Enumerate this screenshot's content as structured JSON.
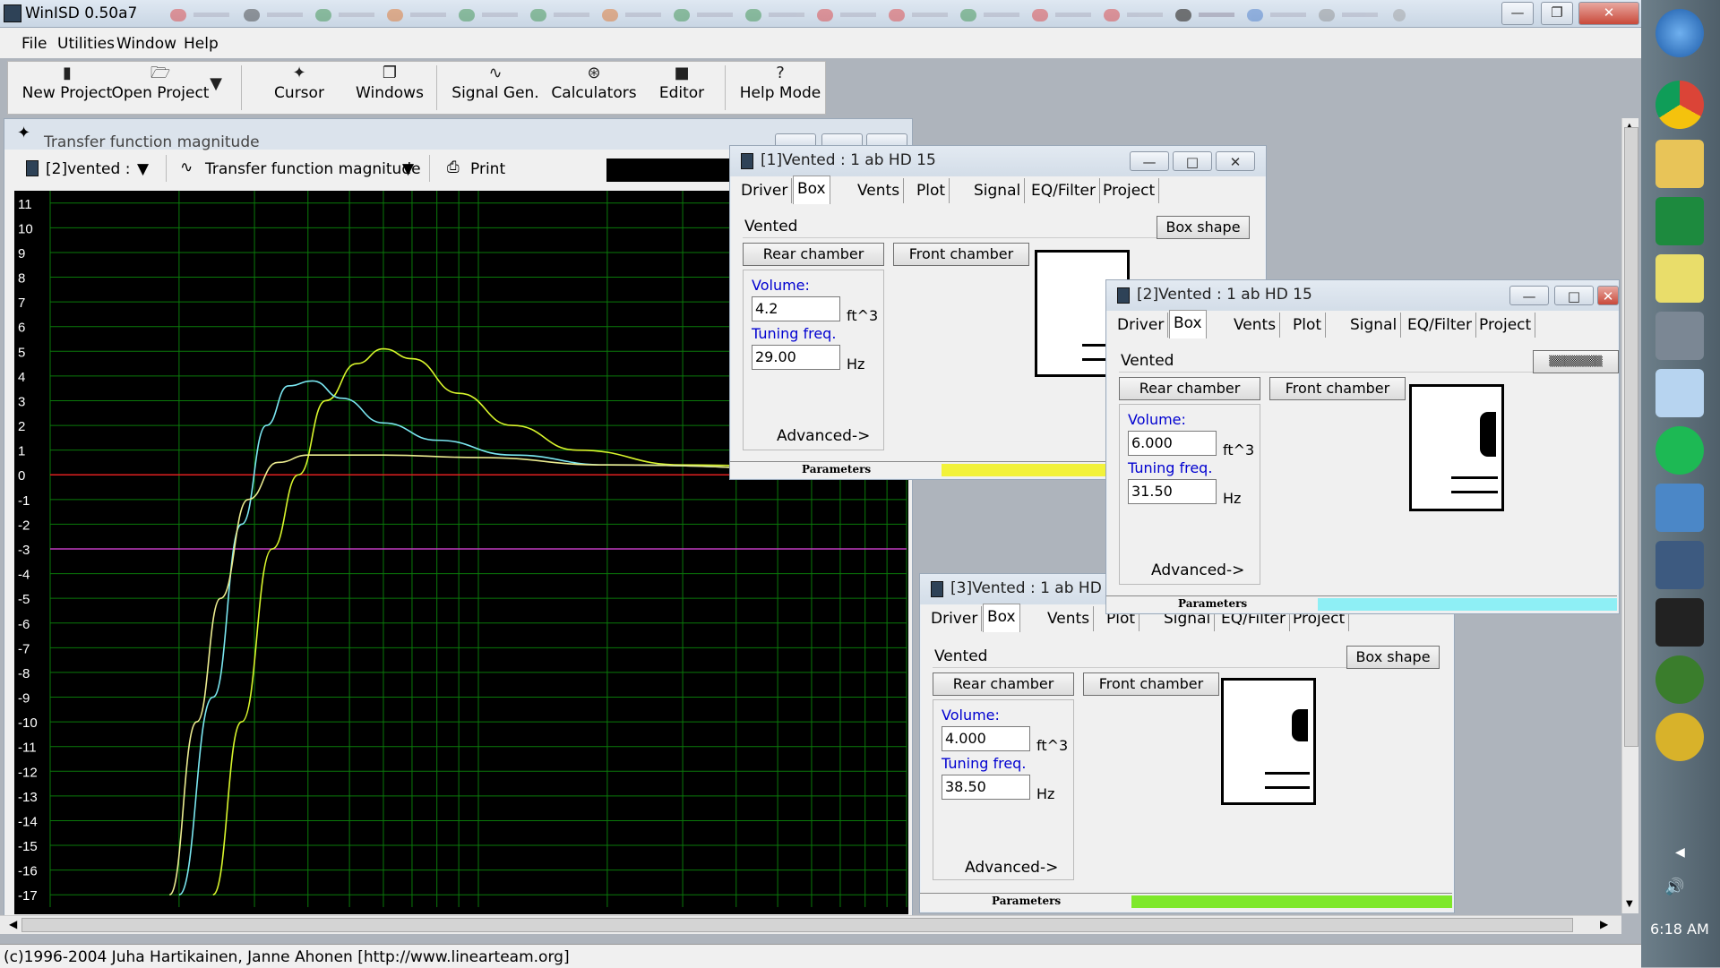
{
  "app": {
    "title": "WinISD 0.50a7"
  },
  "menu": [
    "File",
    "Utilities",
    "Window",
    "Help"
  ],
  "toolbar": {
    "new_project": "New Project",
    "open_project": "Open Project",
    "cursor": "Cursor",
    "windows": "Windows",
    "signal_gen": "Signal Gen.",
    "calculators": "Calculators",
    "editor": "Editor",
    "help_mode": "Help Mode"
  },
  "graph": {
    "title": "Transfer function magnitude",
    "project_select": "[2]vented :",
    "plot_select": "Transfer function magnitude",
    "print": "Print",
    "y_ticks": [
      "11",
      "10",
      "9",
      "8",
      "7",
      "6",
      "5",
      "4",
      "3",
      "2",
      "1",
      "0",
      "-1",
      "-2",
      "-3",
      "-4",
      "-5",
      "-6",
      "-7",
      "-8",
      "-9",
      "-10",
      "-11",
      "-12",
      "-13",
      "-14",
      "-15",
      "-16",
      "-17"
    ]
  },
  "chart_data": {
    "type": "line",
    "ylim": [
      -17.5,
      11.5
    ],
    "grid": true,
    "x_scale": "log",
    "series": [
      {
        "color": "#d8f52c",
        "points": [
          [
            24,
            -17
          ],
          [
            28,
            -10
          ],
          [
            33,
            -3
          ],
          [
            38,
            0
          ],
          [
            44,
            3
          ],
          [
            52,
            4.5
          ],
          [
            60,
            5.1
          ],
          [
            70,
            4.7
          ],
          [
            90,
            3.3
          ],
          [
            120,
            2
          ],
          [
            170,
            1
          ],
          [
            300,
            0.4
          ],
          [
            1000,
            0.1
          ]
        ]
      },
      {
        "color": "#7ae6f0",
        "points": [
          [
            20,
            -17
          ],
          [
            24,
            -9
          ],
          [
            28,
            -2
          ],
          [
            32,
            2
          ],
          [
            36,
            3.6
          ],
          [
            41,
            3.8
          ],
          [
            48,
            3.1
          ],
          [
            60,
            2.1
          ],
          [
            80,
            1.4
          ],
          [
            120,
            0.8
          ],
          [
            200,
            0.4
          ],
          [
            1000,
            0.1
          ]
        ]
      },
      {
        "color": "#ecec90",
        "points": [
          [
            19,
            -17
          ],
          [
            22,
            -10
          ],
          [
            25,
            -5
          ],
          [
            29,
            -1
          ],
          [
            34,
            0.5
          ],
          [
            40,
            0.8
          ],
          [
            60,
            0.8
          ],
          [
            100,
            0.7
          ],
          [
            200,
            0.4
          ],
          [
            1000,
            0.1
          ]
        ]
      }
    ],
    "ref_lines": [
      {
        "y": 0,
        "color": "#e02020"
      },
      {
        "y": -3,
        "color": "#c03cc0"
      }
    ]
  },
  "windows": [
    {
      "title": "[1]Vented : 1 ab HD 15",
      "tabs": [
        "Driver",
        "Box",
        "Vents",
        "Plot",
        "Signal",
        "EQ/Filter",
        "Project"
      ],
      "selected_tab": "Box",
      "type": "Vented",
      "box_shape": "Box shape",
      "rear": "Rear chamber",
      "front": "Front chamber",
      "volume_label": "Volume:",
      "volume": "4.2",
      "volume_unit": "ft^3",
      "tuning_label": "Tuning freq.",
      "tuning": "29.00",
      "tuning_unit": "Hz",
      "advanced": "Advanced->",
      "params": "Parameters",
      "color": "#f2f23a"
    },
    {
      "title": "[2]Vented : 1 ab HD 15",
      "tabs": [
        "Driver",
        "Box",
        "Vents",
        "Plot",
        "Signal",
        "EQ/Filter",
        "Project"
      ],
      "selected_tab": "Box",
      "type": "Vented",
      "box_shape": "Box shape",
      "rear": "Rear chamber",
      "front": "Front chamber",
      "volume_label": "Volume:",
      "volume": "6.000",
      "volume_unit": "ft^3",
      "tuning_label": "Tuning freq.",
      "tuning": "31.50",
      "tuning_unit": "Hz",
      "advanced": "Advanced->",
      "params": "Parameters",
      "color": "#8eeff5"
    },
    {
      "title": "[3]Vented : 1 ab HD 15",
      "tabs": [
        "Driver",
        "Box",
        "Vents",
        "Plot",
        "Signal",
        "EQ/Filter",
        "Project"
      ],
      "selected_tab": "Box",
      "type": "Vented",
      "box_shape": "Box shape",
      "rear": "Rear chamber",
      "front": "Front chamber",
      "volume_label": "Volume:",
      "volume": "4.000",
      "volume_unit": "ft^3",
      "tuning_label": "Tuning freq.",
      "tuning": "38.50",
      "tuning_unit": "Hz",
      "advanced": "Advanced->",
      "params": "Parameters",
      "color": "#7ee82a"
    }
  ],
  "status": {
    "copyright": "(c)1996-2004 Juha Hartikainen, Janne Ahonen [http://www.linearteam.org]"
  },
  "taskbar": {
    "clock": "6:18 AM"
  }
}
